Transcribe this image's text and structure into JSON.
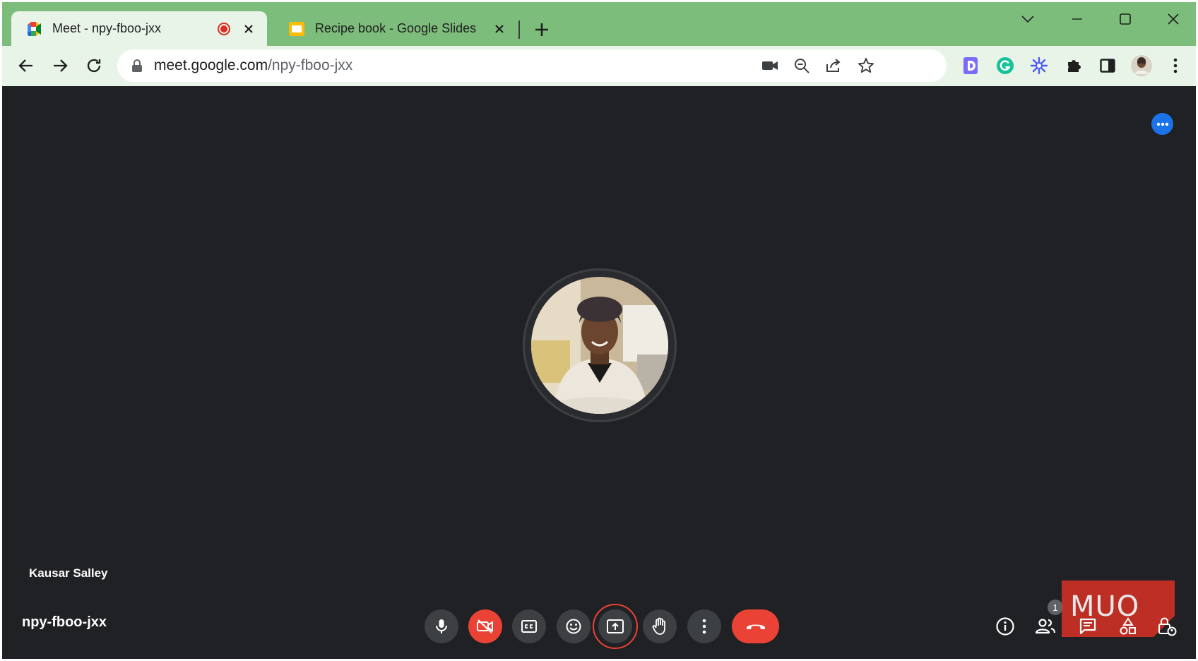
{
  "browser": {
    "tabs": [
      {
        "title": "Meet - npy-fboo-jxx",
        "active": true,
        "recording": true
      },
      {
        "title": "Recipe book - Google Slides",
        "active": false
      }
    ],
    "address": {
      "host": "meet.google.com",
      "path": "/npy-fboo-jxx"
    }
  },
  "meet": {
    "participant_name": "Kausar Salley",
    "meeting_code": "npy-fboo-jxx",
    "people_count": "1"
  },
  "watermark": {
    "text": "MUO"
  },
  "colors": {
    "tabstrip": "#7dbd7c",
    "toolbar": "#e9f4e8",
    "stage": "#202124",
    "control_bg": "#3c4043",
    "danger": "#ea4335",
    "accent_blue": "#1a73e8"
  }
}
